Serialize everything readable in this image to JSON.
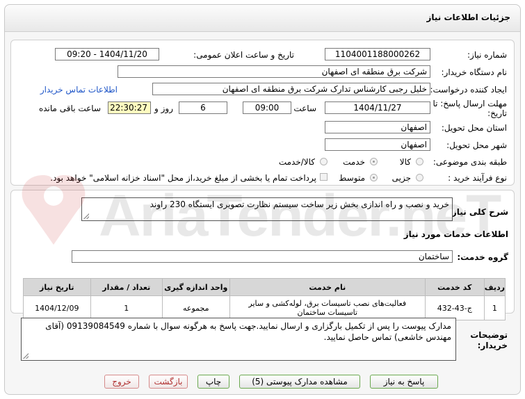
{
  "header": {
    "title": "جزئیات اطلاعات نیاز"
  },
  "form": {
    "need_number_label": "شماره نیاز:",
    "need_number": "1104001188000262",
    "announce_label": "تاریخ و ساعت اعلان عمومی:",
    "announce_value": "1404/11/20 - 09:20",
    "buyer_label": "نام دستگاه خریدار:",
    "buyer_value": "شرکت برق منطقه ای اصفهان",
    "requester_label": "ایجاد کننده درخواست:",
    "requester_value": "خلیل رجبی کارشناس تدارک شرکت برق منطقه ای اصفهان",
    "contact_link": "اطلاعات تماس خریدار",
    "deadline_label_1": "مهلت ارسال پاسخ: تا",
    "deadline_label_2": "تاریخ:",
    "deadline_date": "1404/11/27",
    "time_label": "ساعت",
    "deadline_time": "09:00",
    "days_value": "6",
    "days_label": "روز و",
    "remaining_time": "22:30:27",
    "remaining_label": "ساعت باقی مانده",
    "province_label": "استان محل تحویل:",
    "province_value": "اصفهان",
    "city_label": "شهر محل تحویل:",
    "city_value": "اصفهان",
    "category_label": "طبقه بندی موضوعی:",
    "category_options": [
      "کالا",
      "خدمت",
      "کالا/خدمت"
    ],
    "category_selected": "خدمت",
    "process_label": "نوع فرآیند خرید :",
    "process_options": [
      "جزیی",
      "متوسط"
    ],
    "process_selected": "متوسط",
    "payment_note": "پرداخت تمام یا بخشی از مبلغ خرید،از محل \"اسناد خزانه اسلامی\" خواهد بود."
  },
  "summary": {
    "label": "شرح کلی نیاز:",
    "value": "خرید و نصب و راه اندازی بخش زیر ساخت سیستم نظارت تصویری ایستگاه 230 راوند"
  },
  "services": {
    "section_title": "اطلاعات خدمات مورد نیاز",
    "group_label": "گروه خدمت:",
    "group_value": "ساختمان",
    "columns": [
      "ردیف",
      "کد خدمت",
      "نام خدمت",
      "واحد اندازه گیری",
      "تعداد / مقدار",
      "تاریخ نیاز"
    ],
    "rows": [
      {
        "row": "1",
        "code": "ج-43-432",
        "name_line1": "فعالیت‌های نصب تاسیسات برق، لوله‌کشی و سایر",
        "name_line2": "تاسیسات ساختمان",
        "unit": "مجموعه",
        "qty": "1",
        "date": "1404/12/09"
      }
    ]
  },
  "buyer_notes": {
    "label_1": "توضیحات",
    "label_2": "خریدار:",
    "text": "مدارک پیوست را پس از تکمیل بارگزاری و ارسال نمایید.جهت پاسخ به هرگونه سوال با شماره 09139084549 (آقای مهندس خاشعی) تماس حاصل نمایید."
  },
  "buttons": {
    "reply": "پاسخ به نیاز",
    "attachments": "مشاهده مدارک پیوستی (5)",
    "print": "چاپ",
    "back": "بازگشت",
    "exit": "خروج"
  },
  "watermark_text": "AriaTender.neT"
}
